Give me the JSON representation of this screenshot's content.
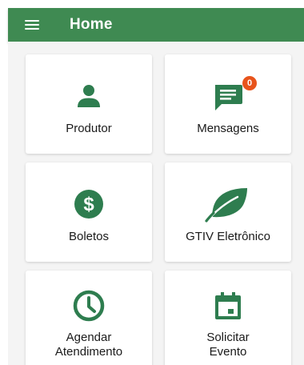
{
  "colors": {
    "primary": "#3f8a52",
    "icon": "#2e7d4f",
    "badge": "#e8541c",
    "background": "#f4f4f4"
  },
  "appbar": {
    "title": "Home",
    "menu_icon": "hamburger-menu-icon"
  },
  "cards": [
    {
      "label": "Produtor",
      "icon": "person-icon"
    },
    {
      "label": "Mensagens",
      "icon": "message-icon",
      "badge": "0"
    },
    {
      "label": "Boletos",
      "icon": "dollar-circle-icon"
    },
    {
      "label": "GTIV Eletrônico",
      "icon": "leaf-icon"
    },
    {
      "label": "Agendar\nAtendimento",
      "icon": "clock-icon"
    },
    {
      "label": "Solicitar\nEvento",
      "icon": "calendar-icon"
    }
  ]
}
